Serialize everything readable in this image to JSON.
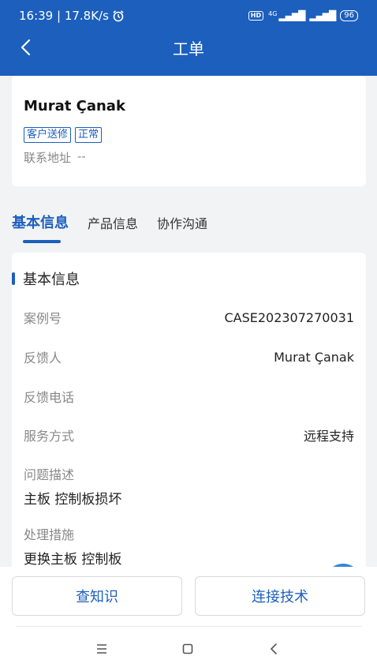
{
  "status_bar": {
    "time_speed": "16:39 | 17.8K/s",
    "hd": "HD",
    "network": "4G",
    "battery": "96"
  },
  "nav": {
    "title": "工单"
  },
  "customer": {
    "name": "Murat Çanak",
    "tags": [
      "客户送修",
      "正常"
    ],
    "address_label": "联系地址",
    "address_value": "--"
  },
  "tabs": [
    {
      "label": "基本信息"
    },
    {
      "label": "产品信息"
    },
    {
      "label": "协作沟通"
    }
  ],
  "detail": {
    "section_title": "基本信息",
    "case_no_label": "案例号",
    "case_no_value": "CASE202307270031",
    "feedback_person_label": "反馈人",
    "feedback_person_value": "Murat Çanak",
    "feedback_phone_label": "反馈电话",
    "feedback_phone_value": "",
    "service_mode_label": "服务方式",
    "service_mode_value": "远程支持",
    "problem_label": "问题描述",
    "problem_value": "主板 控制板损坏",
    "measure_label": "处理措施",
    "measure_value": "更换主板 控制板"
  },
  "actions": {
    "knowledge": "查知识",
    "connect_tech": "连接技术"
  }
}
